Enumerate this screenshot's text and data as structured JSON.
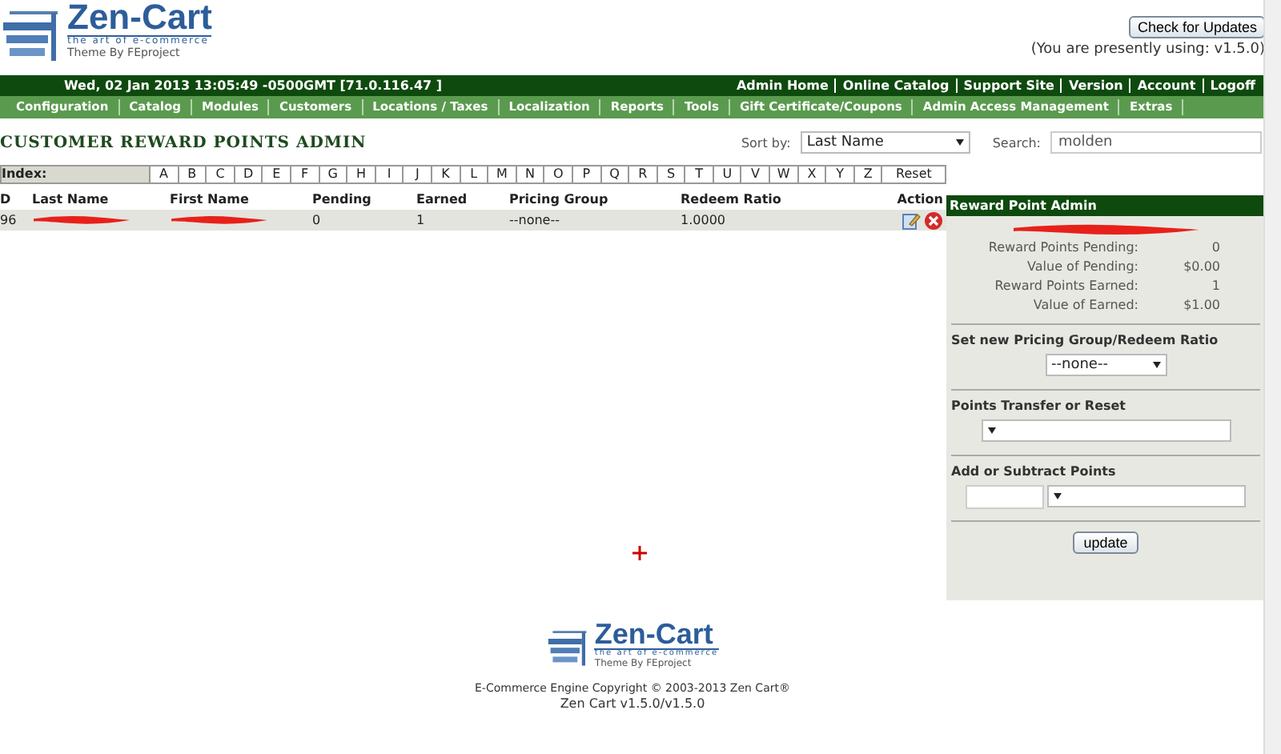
{
  "header": {
    "logo": {
      "name": "Zen-Cart",
      "tagline": "the art of e-commerce",
      "theme": "Theme By FEproject"
    },
    "update_button": "Check for Updates",
    "version_note": "(You are presently using: v1.5.0)"
  },
  "status_bar": {
    "datetime": "Wed, 02 Jan 2013 13:05:49 -0500GMT [71.0.116.47 ]",
    "links": [
      "Admin Home",
      "Online Catalog",
      "Support Site",
      "Version",
      "Account",
      "Logoff"
    ]
  },
  "nav": [
    "Configuration",
    "Catalog",
    "Modules",
    "Customers",
    "Locations / Taxes",
    "Localization",
    "Reports",
    "Tools",
    "Gift Certificate/Coupons",
    "Admin Access Management",
    "Extras"
  ],
  "page": {
    "title": "CUSTOMER REWARD POINTS ADMIN",
    "sort_label": "Sort by:",
    "sort_value": "Last Name",
    "search_label": "Search:",
    "search_value": "molden"
  },
  "index": {
    "label": "Index:",
    "letters": [
      "A",
      "B",
      "C",
      "D",
      "E",
      "F",
      "G",
      "H",
      "I",
      "J",
      "K",
      "L",
      "M",
      "N",
      "O",
      "P",
      "Q",
      "R",
      "S",
      "T",
      "U",
      "V",
      "W",
      "X",
      "Y",
      "Z",
      "Reset"
    ]
  },
  "table": {
    "columns": [
      "D",
      "Last Name",
      "First Name",
      "Pending",
      "Earned",
      "Pricing Group",
      "Redeem Ratio",
      "Action"
    ],
    "rows": [
      {
        "id": "96",
        "pending": "0",
        "earned": "1",
        "pricing_group": "--none--",
        "redeem_ratio": "1.0000",
        "selected": true
      }
    ]
  },
  "panel": {
    "title": "Reward Point Admin",
    "stats": [
      {
        "label": "Reward Points Pending:",
        "value": "0"
      },
      {
        "label": "Value of Pending:",
        "value": "$0.00"
      },
      {
        "label": "Reward Points Earned:",
        "value": "1"
      },
      {
        "label": "Value of Earned:",
        "value": "$1.00"
      }
    ],
    "sections": [
      {
        "title": "Set new Pricing Group/Redeem Ratio",
        "kind": "select",
        "value": "--none--"
      },
      {
        "title": "Points Transfer or Reset",
        "kind": "select"
      },
      {
        "title": "Add or Subtract Points",
        "kind": "input_select"
      }
    ],
    "button": "update"
  },
  "footer": {
    "logo": {
      "name": "Zen-Cart",
      "tagline": "the art of e-commerce",
      "theme": "Theme By FEproject"
    },
    "copyright": "E-Commerce Engine Copyright © 2003-2013 Zen Cart®",
    "version": "Zen Cart v1.5.0/v1.5.0"
  }
}
